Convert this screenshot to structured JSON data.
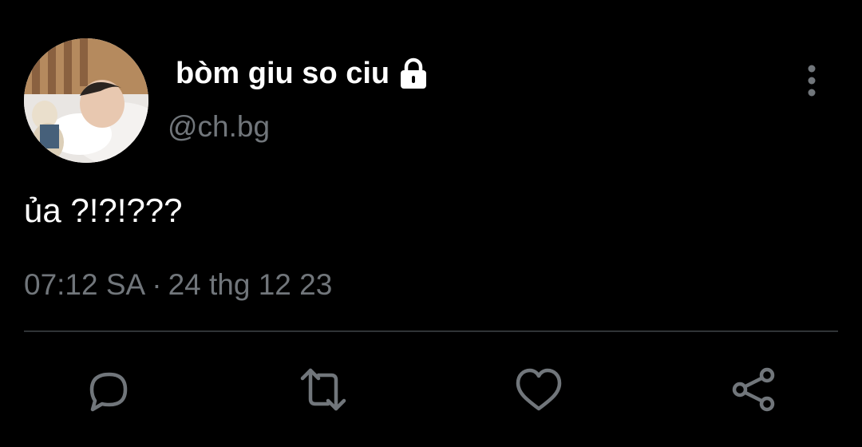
{
  "tweet": {
    "display_name": "bòm giu so ciu",
    "handle": "@ch.bg",
    "text": "ủa ?!?!???",
    "time": "07:12 SA",
    "separator": "·",
    "date": "24 thg 12 23",
    "protected_icon": "lock-icon",
    "avatar_icon": "avatar-photo"
  },
  "actions": [
    {
      "name": "reply",
      "icon": "reply-icon"
    },
    {
      "name": "retweet",
      "icon": "retweet-icon"
    },
    {
      "name": "like",
      "icon": "heart-icon"
    },
    {
      "name": "share",
      "icon": "share-icon"
    }
  ],
  "more_icon": "more-vertical-icon",
  "colors": {
    "background": "#000000",
    "primary_text": "#ffffff",
    "secondary_text": "#71767b",
    "divider": "#2f3336",
    "icon": "#71767b"
  }
}
